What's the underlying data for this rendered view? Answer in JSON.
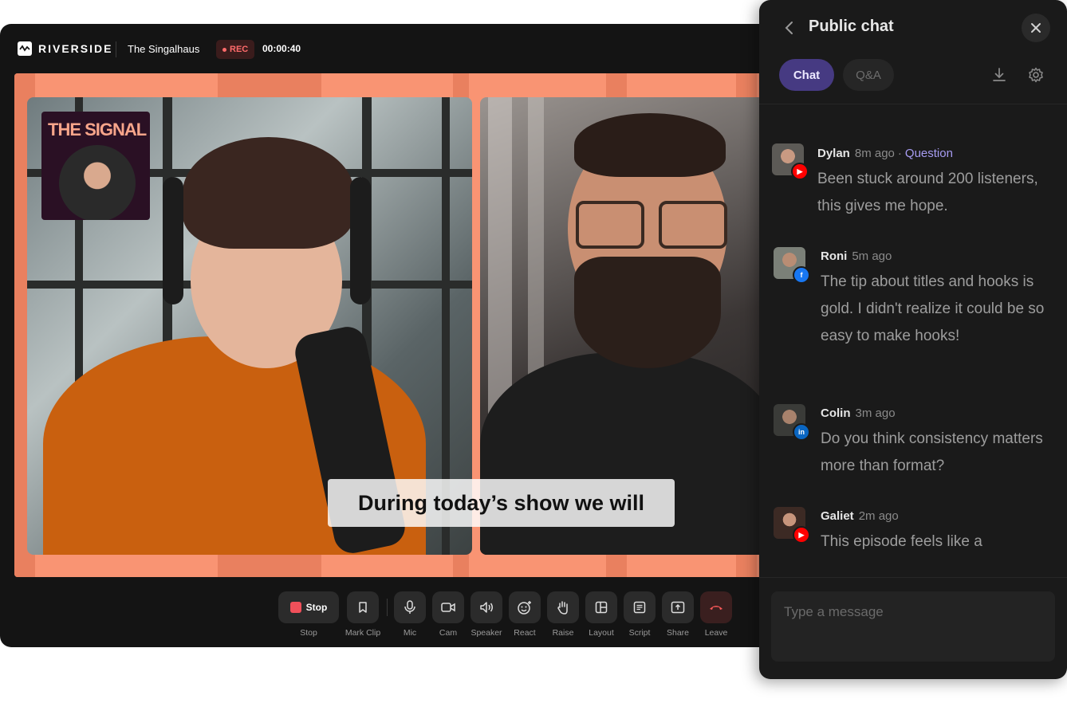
{
  "header": {
    "brand": "RIVERSIDE",
    "studio_name": "The Singalhaus",
    "rec_label": "REC",
    "timer": "00:00:40"
  },
  "stage": {
    "thumbnail_title": "THE SIGNAL",
    "caption": "During today’s show we will"
  },
  "controls": [
    {
      "label": "Stop",
      "button_text": "Stop",
      "icon": "stop-icon"
    },
    {
      "label": "Mark Clip",
      "icon": "bookmark-icon"
    },
    {
      "label": "Mic",
      "icon": "mic-icon"
    },
    {
      "label": "Cam",
      "icon": "camera-icon"
    },
    {
      "label": "Speaker",
      "icon": "speaker-icon"
    },
    {
      "label": "React",
      "icon": "emoji-icon"
    },
    {
      "label": "Raise",
      "icon": "hand-icon"
    },
    {
      "label": "Layout",
      "icon": "layout-icon"
    },
    {
      "label": "Script",
      "icon": "script-icon"
    },
    {
      "label": "Share",
      "icon": "share-screen-icon"
    },
    {
      "label": "Leave",
      "icon": "phone-hangup-icon"
    }
  ],
  "chat": {
    "title": "Public chat",
    "tabs": [
      "Chat",
      "Q&A"
    ],
    "active_tab": "Chat",
    "input_placeholder": "Type a message",
    "messages": [
      {
        "name": "Dylan",
        "time": "8m ago",
        "tag": "Question",
        "platform": "youtube",
        "text": "Been stuck around 200 listeners, this gives me hope."
      },
      {
        "name": "Roni",
        "time": "5m ago",
        "platform": "facebook",
        "text": "The tip about titles and hooks is gold. I didn't realize it could be so easy to make hooks!"
      },
      {
        "name": "Colin",
        "time": "3m ago",
        "platform": "linkedin",
        "text": "Do you think consistency matters more than format?"
      },
      {
        "name": "Galiet",
        "time": "2m ago",
        "platform": "youtube",
        "text": "This episode feels like a"
      }
    ]
  },
  "colors": {
    "accent_purple": "#463a82",
    "rec_red": "#ff6b6b",
    "stage_orange": "#f99473",
    "youtube": "#ff0000",
    "facebook": "#1877f2",
    "linkedin": "#0a66c2"
  }
}
